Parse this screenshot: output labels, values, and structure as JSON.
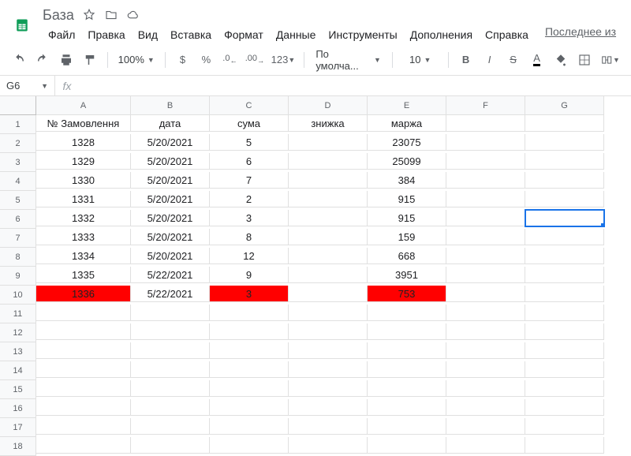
{
  "doc": {
    "title": "База"
  },
  "menus": [
    "Файл",
    "Правка",
    "Вид",
    "Вставка",
    "Формат",
    "Данные",
    "Инструменты",
    "Дополнения",
    "Справка"
  ],
  "last_edit": "Последнее из",
  "toolbar": {
    "zoom": "100%",
    "currency": "$",
    "percent": "%",
    "dec_dec": ".0",
    "dec_inc": ".00",
    "numfmt": "123",
    "font": "По умолча...",
    "fontsize": "10",
    "bold": "B",
    "italic": "I",
    "strike": "S",
    "textcolor": "A"
  },
  "namebox": "G6",
  "columns": [
    "A",
    "B",
    "C",
    "D",
    "E",
    "F",
    "G"
  ],
  "row_count": 18,
  "header_row": [
    "№ Замовлення",
    "дата",
    "сума",
    "знижка",
    "маржа",
    "",
    ""
  ],
  "data_rows": [
    [
      "1328",
      "5/20/2021",
      "5",
      "",
      "23075",
      "",
      ""
    ],
    [
      "1329",
      "5/20/2021",
      "6",
      "",
      "25099",
      "",
      ""
    ],
    [
      "1330",
      "5/20/2021",
      "7",
      "",
      "384",
      "",
      ""
    ],
    [
      "1331",
      "5/20/2021",
      "2",
      "",
      "915",
      "",
      ""
    ],
    [
      "1332",
      "5/20/2021",
      "3",
      "",
      "915",
      "",
      ""
    ],
    [
      "1333",
      "5/20/2021",
      "8",
      "",
      "159",
      "",
      ""
    ],
    [
      "1334",
      "5/20/2021",
      "12",
      "",
      "668",
      "",
      ""
    ],
    [
      "1335",
      "5/22/2021",
      "9",
      "",
      "3951",
      "",
      ""
    ],
    [
      "1336",
      "5/22/2021",
      "3",
      "",
      "753",
      "",
      ""
    ]
  ],
  "highlight_row_index": 8,
  "highlight_cols": [
    0,
    2,
    4
  ],
  "selected_cell": {
    "row": 6,
    "col": 6
  },
  "chart_data": {
    "type": "table",
    "columns": [
      "№ Замовлення",
      "дата",
      "сума",
      "знижка",
      "маржа"
    ],
    "rows": [
      [
        1328,
        "5/20/2021",
        5,
        null,
        23075
      ],
      [
        1329,
        "5/20/2021",
        6,
        null,
        25099
      ],
      [
        1330,
        "5/20/2021",
        7,
        null,
        384
      ],
      [
        1331,
        "5/20/2021",
        2,
        null,
        915
      ],
      [
        1332,
        "5/20/2021",
        3,
        null,
        915
      ],
      [
        1333,
        "5/20/2021",
        8,
        null,
        159
      ],
      [
        1334,
        "5/20/2021",
        12,
        null,
        668
      ],
      [
        1335,
        "5/22/2021",
        9,
        null,
        3951
      ],
      [
        1336,
        "5/22/2021",
        3,
        null,
        753
      ]
    ]
  }
}
